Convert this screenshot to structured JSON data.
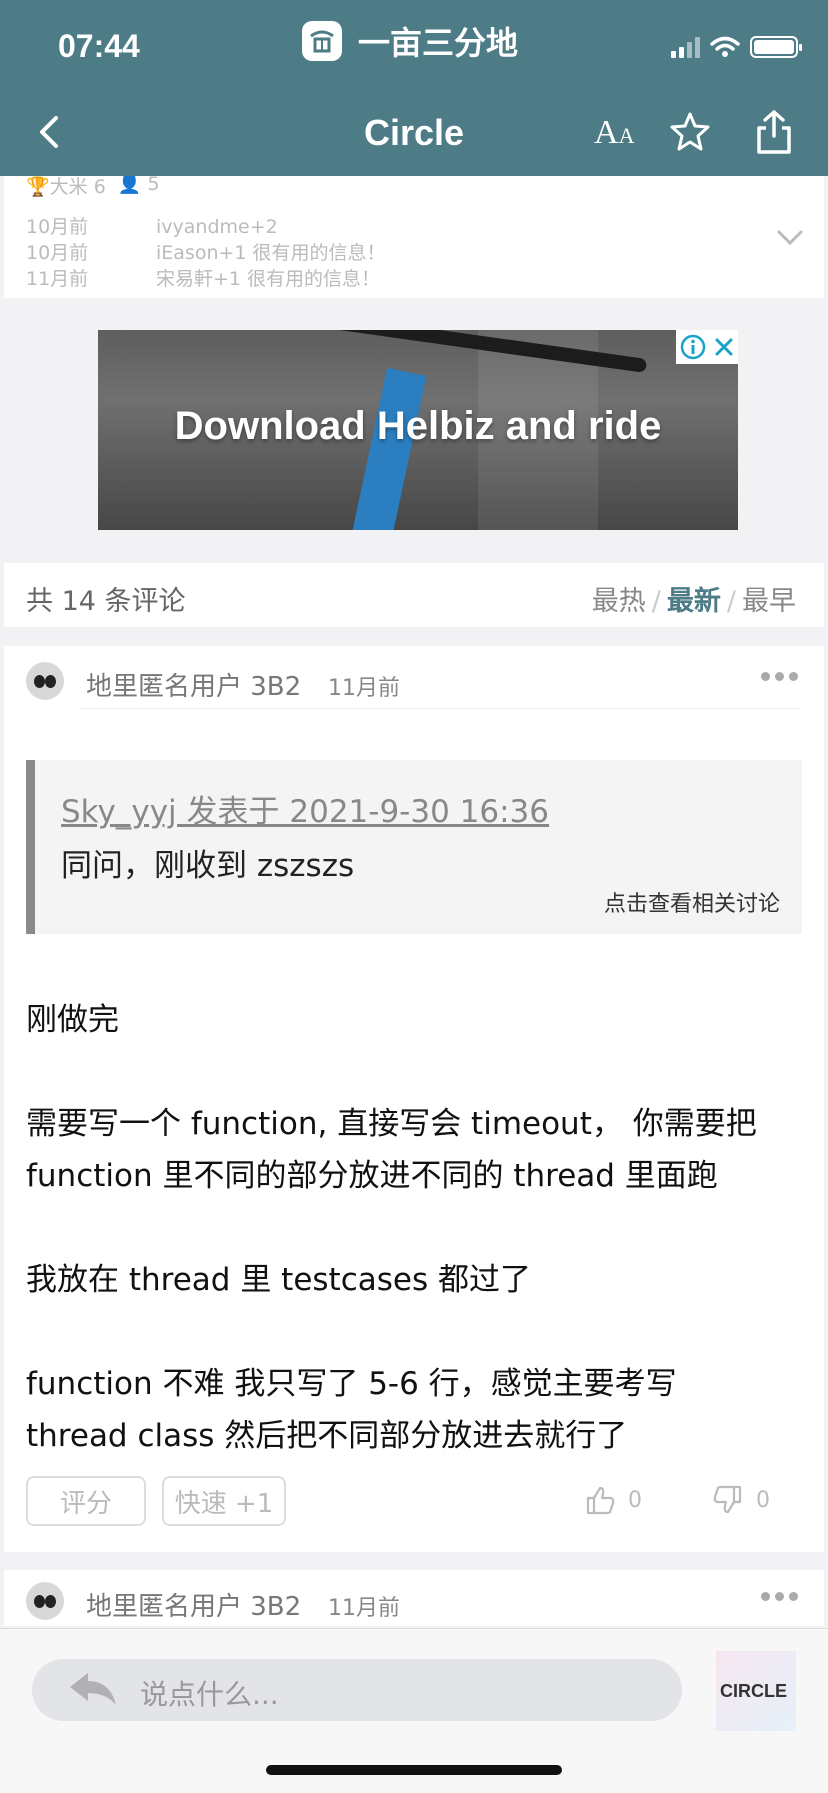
{
  "status": {
    "time": "07:44",
    "app_name": "一亩三分地"
  },
  "nav": {
    "title": "Circle",
    "font_label_big": "A",
    "font_label_small": "A"
  },
  "ratings": {
    "trophy_text": "🏆大米 6",
    "people_text": "👤 5",
    "rows": [
      {
        "when": "10月前",
        "text": "ivyandme+2"
      },
      {
        "when": "10月前",
        "text": "iEason+1 很有用的信息！"
      },
      {
        "when": "11月前",
        "text": "宋易軒+1 很有用的信息！"
      }
    ]
  },
  "ad": {
    "headline": "Download Helbiz and ride",
    "info_icon": "info-icon",
    "close_icon": "close-icon"
  },
  "comments": {
    "count": "共 14 条评论",
    "sort": [
      "最热",
      "最新",
      "最早"
    ],
    "sort_separator": "/",
    "active_sort": "最新"
  },
  "post": {
    "user": "地里匿名用户 3B2",
    "time": "11月前",
    "quote": {
      "link": "Sky_yyj 发表于 2021-9-30 16:36",
      "text": "同问，刚收到 zszszs",
      "more": "点击查看相关讨论"
    },
    "lines": [
      "刚做完",
      "需要写一个 function, 直接写会 timeout， 你需要把",
      "function 里不同的部分放进不同的 thread 里面跑",
      "我放在 thread 里 testcases 都过了",
      "function 不难 我只写了 5-6 行，感觉主要考写",
      "thread class 然后把不同部分放进去就行了"
    ],
    "rate_label": "评分",
    "quick_label": "快速 +1",
    "likes": "0",
    "dislikes": "0"
  },
  "post2": {
    "user": "地里匿名用户 3B2",
    "time": "11月前"
  },
  "bottom": {
    "placeholder": "说点什么...",
    "ad_text": "CIRCLE"
  },
  "colors": {
    "header": "#4d7b86",
    "active_sort": "#4d7b86"
  }
}
